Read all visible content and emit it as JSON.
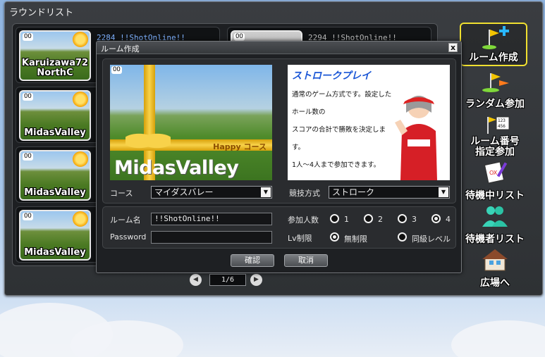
{
  "window": {
    "title": "ラウンドリスト"
  },
  "rooms": [
    {
      "course": "Karuizawa72\nNorthC",
      "course_line1": "Karuizawa72",
      "course_line2": "NorthC",
      "info": "2284 !!ShotOnline!!"
    },
    {
      "info": "2294 !!ShotOnline!!"
    },
    {
      "course": "MidasValley"
    },
    {
      "course": "MidasValley"
    },
    {
      "course": "MidasValley"
    }
  ],
  "pager": {
    "page": "1/6"
  },
  "side_buttons": [
    {
      "label": "ルーム作成",
      "icon": "flag-plus-icon"
    },
    {
      "label": "ランダム参加",
      "icon": "flag-random-icon"
    },
    {
      "label_line1": "ルーム番号",
      "label_line2": "指定参加",
      "icon": "flag-number-icon"
    },
    {
      "label": "待機中リスト",
      "icon": "waiting-list-icon"
    },
    {
      "label": "待機者リスト",
      "icon": "waiting-users-icon"
    },
    {
      "label": "広場へ",
      "icon": "plaza-house-icon"
    }
  ],
  "dialog": {
    "title": "ルーム作成",
    "close": "x",
    "course_image": {
      "happy": "Happy コース",
      "name": "MidasValley"
    },
    "mode_image": {
      "title": "ストロークプレイ",
      "lines": [
        "通常のゲーム方式です。設定したホール数の",
        "スコアの合計で勝敗を決定します。",
        "1人～4人まで参加できます。"
      ]
    },
    "course_label": "コース",
    "course_value": "マイダスバレー",
    "mode_label": "競技方式",
    "mode_value": "ストローク",
    "room_name_label": "ルーム名",
    "room_name_value": "!!ShotOnline!!",
    "password_label": "Password",
    "password_value": "",
    "players_label": "参加人数",
    "players_options": [
      "1",
      "2",
      "3",
      "4"
    ],
    "players_selected": "4",
    "lv_label": "Lv制限",
    "lv_options": [
      "無制限",
      "同級レベル"
    ],
    "lv_selected": "無制限",
    "confirm": "確認",
    "cancel": "取消"
  },
  "colors": {
    "accent": "#f0e030",
    "link": "#7fb2ff",
    "title_blue": "#1b57d6"
  }
}
